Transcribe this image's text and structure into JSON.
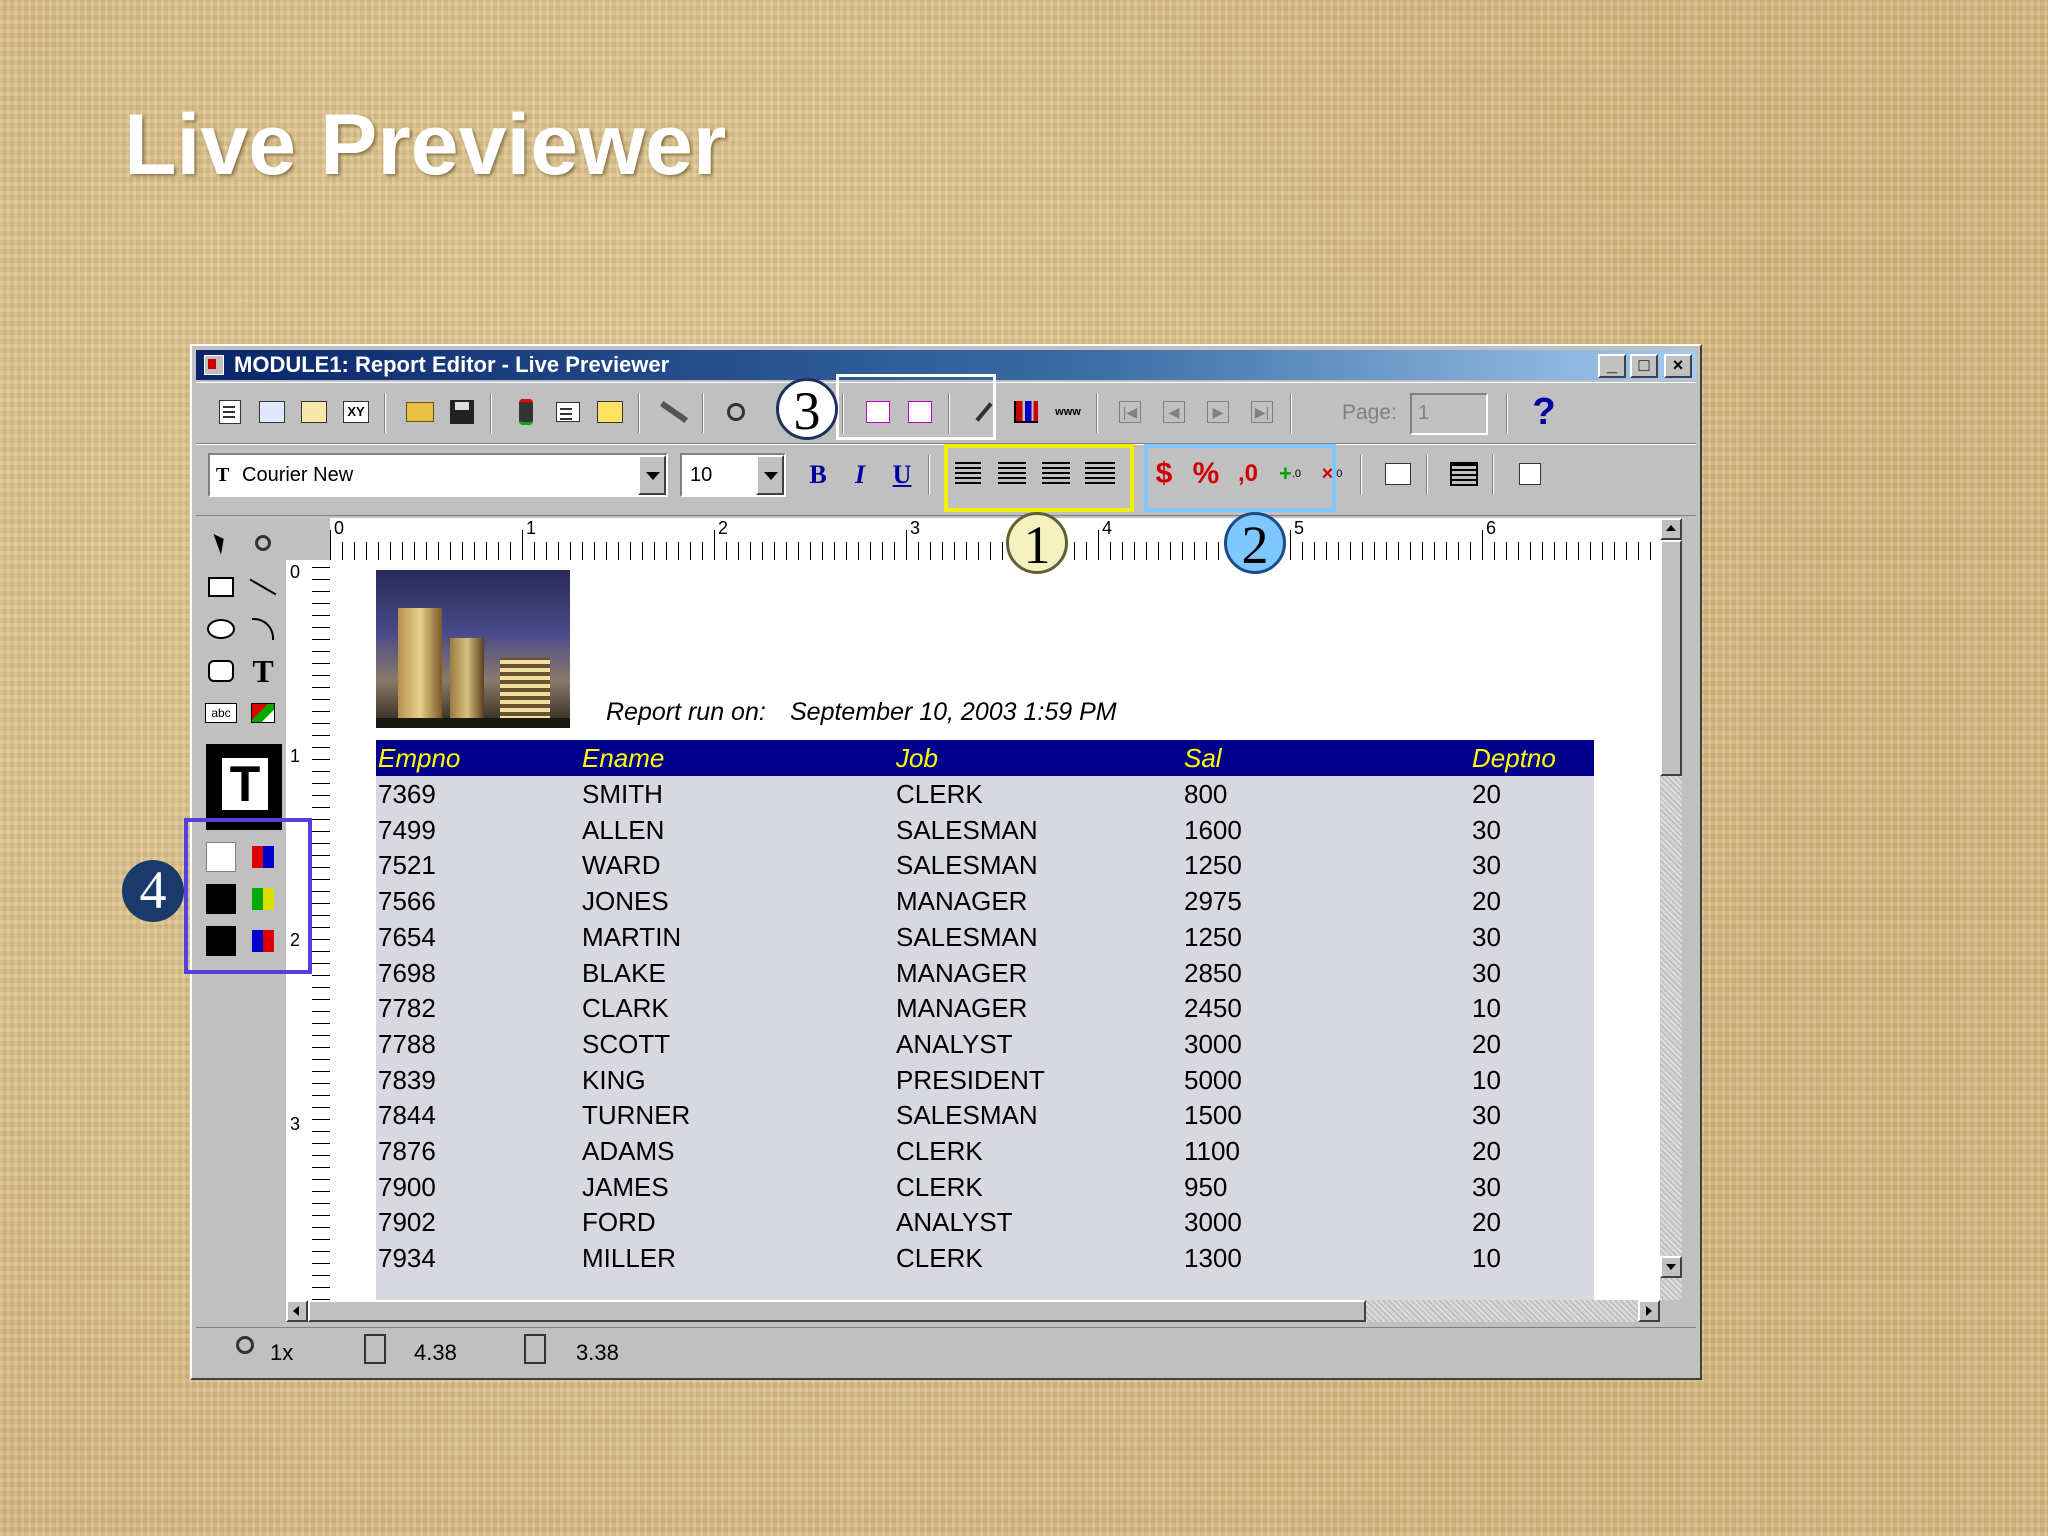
{
  "slide": {
    "title": "Live Previewer"
  },
  "window": {
    "title": "MODULE1: Report Editor - Live Previewer",
    "buttons": {
      "minimize": "_",
      "maximize": "□",
      "close": "×"
    }
  },
  "toolbar": {
    "page_label": "Page:",
    "page_value": "1",
    "help_label": "?"
  },
  "format_bar": {
    "font_name": "Courier New",
    "font_size": "10",
    "bold": "B",
    "italic": "I",
    "underline": "U",
    "currency": "$",
    "percent": "%",
    "comma": ",0"
  },
  "callouts": [
    "1",
    "2",
    "3",
    "4"
  ],
  "callout_colors": {
    "1": "#f0f000",
    "2": "#7fc8ff",
    "3": "#ffffff",
    "4": "#5040e0"
  },
  "ruler": {
    "h_labels": [
      "0",
      "1",
      "2",
      "3",
      "4",
      "5",
      "6"
    ],
    "v_labels": [
      "0",
      "1",
      "2",
      "3"
    ]
  },
  "report": {
    "run_label": "Report run on:",
    "run_date": "September 10, 2003 1:59 PM",
    "columns": [
      "Empno",
      "Ename",
      "Job",
      "Sal",
      "Deptno"
    ],
    "rows": [
      [
        "7369",
        "SMITH",
        "CLERK",
        "800",
        "20"
      ],
      [
        "7499",
        "ALLEN",
        "SALESMAN",
        "1600",
        "30"
      ],
      [
        "7521",
        "WARD",
        "SALESMAN",
        "1250",
        "30"
      ],
      [
        "7566",
        "JONES",
        "MANAGER",
        "2975",
        "20"
      ],
      [
        "7654",
        "MARTIN",
        "SALESMAN",
        "1250",
        "30"
      ],
      [
        "7698",
        "BLAKE",
        "MANAGER",
        "2850",
        "30"
      ],
      [
        "7782",
        "CLARK",
        "MANAGER",
        "2450",
        "10"
      ],
      [
        "7788",
        "SCOTT",
        "ANALYST",
        "3000",
        "20"
      ],
      [
        "7839",
        "KING",
        "PRESIDENT",
        "5000",
        "10"
      ],
      [
        "7844",
        "TURNER",
        "SALESMAN",
        "1500",
        "30"
      ],
      [
        "7876",
        "ADAMS",
        "CLERK",
        "1100",
        "20"
      ],
      [
        "7900",
        "JAMES",
        "CLERK",
        "950",
        "30"
      ],
      [
        "7902",
        "FORD",
        "ANALYST",
        "3000",
        "20"
      ],
      [
        "7934",
        "MILLER",
        "CLERK",
        "1300",
        "10"
      ]
    ]
  },
  "status": {
    "zoom": "1x",
    "x_pos": "4.38",
    "y_pos": "3.38"
  },
  "colors": {
    "table_header_bg": "#00008a",
    "table_header_text": "#ffff00",
    "table_body_bg": "#d8d8e0"
  }
}
